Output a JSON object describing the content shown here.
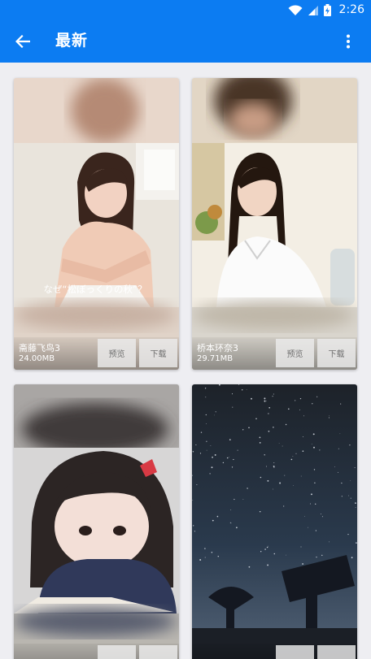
{
  "status_bar": {
    "time": "2:26",
    "icons": [
      "wifi-icon",
      "signal-icon",
      "battery-charging-icon"
    ]
  },
  "app_bar": {
    "title": "最新",
    "back_icon": "arrow-left-icon",
    "menu_icon": "more-vertical-icon",
    "background_color": "#0c7cf2"
  },
  "cards": [
    {
      "name": "斋藤飞鸟3",
      "size": "24.00MB",
      "preview_label": "预览",
      "download_label": "下载",
      "image_caption": "なぜ“松ぼっくりの秋”？"
    },
    {
      "name": "桥本环奈3",
      "size": "29.71MB",
      "preview_label": "预览",
      "download_label": "下载"
    },
    {
      "name": "",
      "size": "",
      "preview_label": "",
      "download_label": ""
    },
    {
      "name": "",
      "size": "",
      "preview_label": "",
      "download_label": ""
    }
  ]
}
